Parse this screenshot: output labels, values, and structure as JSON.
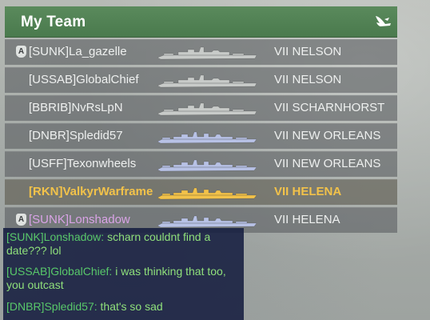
{
  "team_panel": {
    "title": "My Team",
    "header_icon": "bird-icon",
    "colors": {
      "header_green": "#4a7a4d",
      "self_highlight": "#f2c24a",
      "clan_highlight": "#d9a3e6",
      "silhouette_battleship": "#c8cbc9",
      "silhouette_cruiser": "#b8c2e6",
      "silhouette_self": "#f2c24a"
    },
    "players": [
      {
        "badge": "A",
        "name": "[SUNK]La_gazelle",
        "ship": "VII NELSON",
        "ship_class": "battleship"
      },
      {
        "badge": "",
        "name": "[USSAB]GlobalChief",
        "ship": "VII NELSON",
        "ship_class": "battleship"
      },
      {
        "badge": "",
        "name": "[BBRIB]NvRsLpN",
        "ship": "VII SCHARNHORST",
        "ship_class": "battleship"
      },
      {
        "badge": "",
        "name": "[DNBR]Spledid57",
        "ship": "VII NEW ORLEANS",
        "ship_class": "cruiser"
      },
      {
        "badge": "",
        "name": "[USFF]Texonwheels",
        "ship": "VII NEW ORLEANS",
        "ship_class": "cruiser"
      },
      {
        "badge": "",
        "name": "[RKN]ValkyrWarframe",
        "ship": "VII HELENA",
        "ship_class": "self"
      },
      {
        "badge": "A",
        "name": "[SUNK]Lonshadow",
        "ship": "VII HELENA",
        "ship_class": "cruiser"
      }
    ]
  },
  "chat": {
    "messages": [
      {
        "sender": "[SUNK]Lonshadow:",
        "text": "scharn couldnt find a date???   lol"
      },
      {
        "sender": "[USSAB]GlobalChief:",
        "text": "i was thinking that too, you outcast"
      },
      {
        "sender": "[DNBR]Spledid57:",
        "text": "that's so sad"
      }
    ]
  }
}
